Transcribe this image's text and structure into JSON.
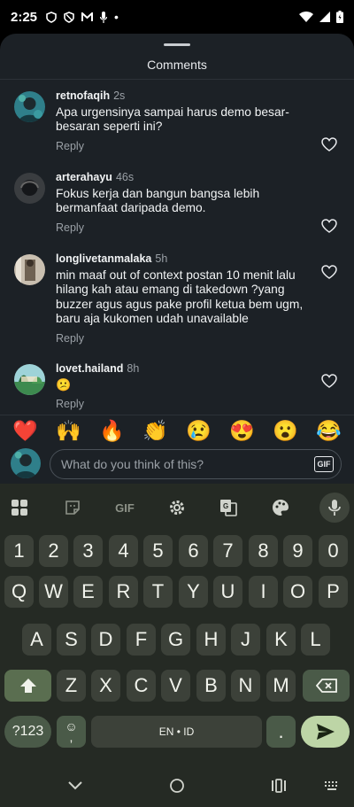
{
  "status": {
    "time": "2:25",
    "dot": "•"
  },
  "sheet": {
    "title": "Comments"
  },
  "comments": [
    {
      "user": "retnofaqih",
      "time": "2s",
      "text": "Apa urgensinya sampai harus demo besar-besaran seperti ini?",
      "reply": "Reply"
    },
    {
      "user": "arterahayu",
      "time": "46s",
      "text": "Fokus kerja dan bangun bangsa lebih bermanfaat daripada demo.",
      "reply": "Reply"
    },
    {
      "user": "longlivetanmalaka",
      "time": "5h",
      "text": "min maaf out of context postan 10 menit lalu hilang kah atau emang di takedown ?yang buzzer agus agus pake profil ketua bem ugm, baru aja kukomen udah unavailable",
      "reply": "Reply"
    },
    {
      "user": "lovet.hailand",
      "time": "8h",
      "text": "😕",
      "reply": "Reply"
    }
  ],
  "emojis": [
    "❤️",
    "🙌",
    "🔥",
    "👏",
    "😢",
    "😍",
    "😮",
    "😂"
  ],
  "compose": {
    "placeholder": "What do you think of this?",
    "gif": "GIF"
  },
  "keyboard": {
    "gif_label": "GIF",
    "row_numbers": [
      "1",
      "2",
      "3",
      "4",
      "5",
      "6",
      "7",
      "8",
      "9",
      "0"
    ],
    "row_q": [
      "Q",
      "W",
      "E",
      "R",
      "T",
      "Y",
      "U",
      "I",
      "O",
      "P"
    ],
    "row_a": [
      "A",
      "S",
      "D",
      "F",
      "G",
      "H",
      "J",
      "K",
      "L"
    ],
    "row_z": [
      "Z",
      "X",
      "C",
      "V",
      "B",
      "N",
      "M"
    ],
    "sym_label": "?123",
    "emoji_key_top": "☺",
    "emoji_key_bottom": ",",
    "space_label": "EN • ID",
    "period": "."
  }
}
